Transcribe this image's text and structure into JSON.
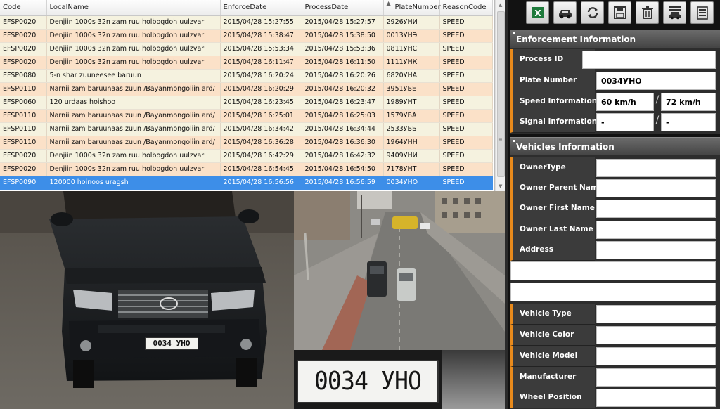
{
  "table": {
    "columns": [
      "Code",
      "LocalName",
      "EnforceDate",
      "ProcessDate",
      "PlateNumber",
      "ReasonCode"
    ],
    "rows": [
      [
        "EFSP0020",
        "Denjiin 1000s 32n zam ruu holbogdoh uulzvar",
        "2015/04/28 15:27:55",
        "2015/04/28 15:27:57",
        "2926УНИ",
        "SPEED"
      ],
      [
        "EFSP0020",
        "Denjiin 1000s 32n zam ruu holbogdoh uulzvar",
        "2015/04/28 15:38:47",
        "2015/04/28 15:38:50",
        "0013УНЭ",
        "SPEED"
      ],
      [
        "EFSP0020",
        "Denjiin 1000s 32n zam ruu holbogdoh uulzvar",
        "2015/04/28 15:53:34",
        "2015/04/28 15:53:36",
        "0811УНС",
        "SPEED"
      ],
      [
        "EFSP0020",
        "Denjiin 1000s 32n zam ruu holbogdoh uulzvar",
        "2015/04/28 16:11:47",
        "2015/04/28 16:11:50",
        "1111УНК",
        "SPEED"
      ],
      [
        "EFSP0080",
        "5-n shar zuuneesee baruun",
        "2015/04/28 16:20:24",
        "2015/04/28 16:20:26",
        "6820УНА",
        "SPEED"
      ],
      [
        "EFSP0110",
        "Narnii zam baruunaas zuun /Bayanmongoliin ard/",
        "2015/04/28 16:20:29",
        "2015/04/28 16:20:32",
        "3951УБЕ",
        "SPEED"
      ],
      [
        "EFSP0060",
        "120 urdaas hoishoo",
        "2015/04/28 16:23:45",
        "2015/04/28 16:23:47",
        "1989УНТ",
        "SPEED"
      ],
      [
        "EFSP0110",
        "Narnii zam baruunaas zuun /Bayanmongoliin ard/",
        "2015/04/28 16:25:01",
        "2015/04/28 16:25:03",
        "1579УБА",
        "SPEED"
      ],
      [
        "EFSP0110",
        "Narnii zam baruunaas zuun /Bayanmongoliin ard/",
        "2015/04/28 16:34:42",
        "2015/04/28 16:34:44",
        "2533УББ",
        "SPEED"
      ],
      [
        "EFSP0110",
        "Narnii zam baruunaas zuun /Bayanmongoliin ard/",
        "2015/04/28 16:36:28",
        "2015/04/28 16:36:30",
        "1964УНН",
        "SPEED"
      ],
      [
        "EFSP0020",
        "Denjiin 1000s 32n zam ruu holbogdoh uulzvar",
        "2015/04/28 16:42:29",
        "2015/04/28 16:42:32",
        "9409УНИ",
        "SPEED"
      ],
      [
        "EFSP0020",
        "Denjiin 1000s 32n zam ruu holbogdoh uulzvar",
        "2015/04/28 16:54:45",
        "2015/04/28 16:54:50",
        "7178УНТ",
        "SPEED"
      ],
      [
        "EFSP0090",
        "120000 hoinoos uragsh",
        "2015/04/28 16:56:56",
        "2015/04/28 16:56:59",
        "0034УНО",
        "SPEED"
      ]
    ]
  },
  "photos": {
    "car_plate_text": "0034 УНО",
    "plate_closeup_text": "0034 УНО"
  },
  "toolbar": {
    "buttons": [
      "excel-icon",
      "car-icon",
      "refresh-icon",
      "save-icon",
      "trash-icon",
      "car-wash-icon",
      "list-icon"
    ],
    "excel_glyph": "X"
  },
  "enforcement": {
    "title": "Enforcement Information",
    "process_id_label": "Process ID",
    "process_id_value": "",
    "plate_number_label": "Plate Number",
    "plate_number_value": "0034УНО",
    "speed_label": "Speed Information",
    "speed_limit": "60 km/h",
    "speed_measured": "72 km/h",
    "signal_label": "Signal Information",
    "signal_value_1": "-",
    "signal_value_2": "-",
    "separator": "/"
  },
  "vehicles": {
    "title": "Vehicles Information",
    "owner_type_label": "OwnerType",
    "owner_parent_name_label": "Owner Parent Name",
    "owner_first_name_label": "Owner First Name",
    "owner_last_name_label": "Owner Last Name",
    "address_label": "Address",
    "vehicle_type_label": "Vehicle Type",
    "vehicle_color_label": "Vehicle Color",
    "vehicle_model_label": "Vehicle Model",
    "manufacturer_label": "Manufacturer",
    "wheel_position_label": "Wheel Position"
  },
  "colors": {
    "row_odd": "#f5f2df",
    "row_even": "#fbe1c8",
    "row_selected": "#3d8ee8",
    "label_accent": "#e88a1c",
    "panel_bg": "#121212"
  }
}
